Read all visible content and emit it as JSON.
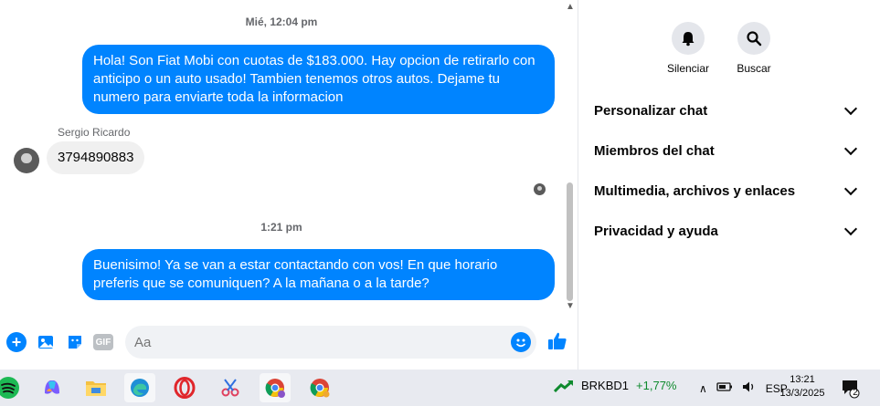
{
  "chat": {
    "timestamp1": "Mié, 12:04 pm",
    "message_out1": "Hola! Son Fiat Mobi con cuotas de $183.000. Hay opcion de retirarlo con anticipo o un auto usado! Tambien tenemos otros autos. Dejame tu numero para enviarte toda la informacion",
    "sender_name": "Sergio Ricardo",
    "message_in1": "3794890883",
    "timestamp2": "1:21 pm",
    "message_out2": "Buenisimo! Ya se van a estar contactando con vos! En que horario preferis que se comuniquen? A la mañana o a la tarde?"
  },
  "composer": {
    "placeholder": "Aa",
    "gif_label": "GIF"
  },
  "panel": {
    "mute_label": "Silenciar",
    "search_label": "Buscar",
    "sections": [
      "Personalizar chat",
      "Miembros del chat",
      "Multimedia, archivos y enlaces",
      "Privacidad y ayuda"
    ]
  },
  "taskbar": {
    "ticker_symbol": "BRKBD1",
    "ticker_change": "+1,77%",
    "language": "ESP",
    "time": "13:21",
    "date": "13/3/2025",
    "notification_count": "2"
  },
  "colors": {
    "messenger_blue": "#0084ff",
    "incoming_bubble": "#f0f0f0",
    "ticker_green": "#0f8a2e"
  }
}
